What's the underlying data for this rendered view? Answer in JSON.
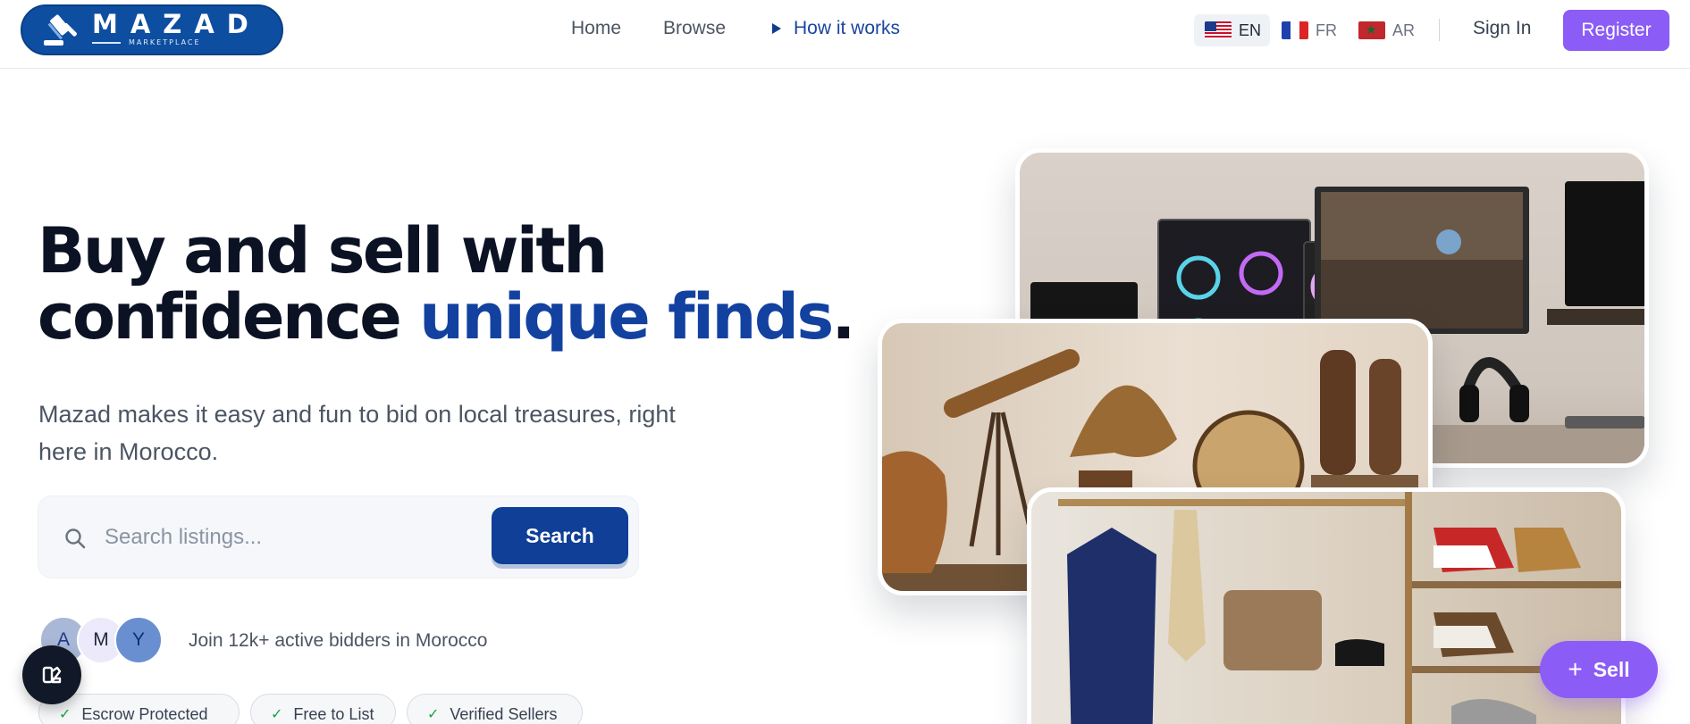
{
  "brand": {
    "name": "MAZAD",
    "tagline": "MARKETPLACE",
    "primary_color": "#0d4ea0",
    "accent_color": "#8b5cf6",
    "dark_color": "#0b1224"
  },
  "nav": {
    "home": "Home",
    "browse": "Browse",
    "how_it_works": "How it works"
  },
  "languages": [
    {
      "code": "EN",
      "flag": "us-flag-icon",
      "selected": true
    },
    {
      "code": "FR",
      "flag": "france-flag-icon",
      "selected": false
    },
    {
      "code": "AR",
      "flag": "morocco-flag-icon",
      "selected": false
    }
  ],
  "auth": {
    "sign_in": "Sign In",
    "register": "Register"
  },
  "hero": {
    "title_line1": "Buy and sell with",
    "title_line2_plain": "confidence ",
    "title_line2_accent": "unique finds",
    "title_period": ".",
    "description": "Mazad makes it easy and fun to bid on local treasures, right here in Morocco."
  },
  "search": {
    "placeholder": "Search listings...",
    "value": "",
    "button": "Search",
    "icon": "search-icon"
  },
  "social_proof": {
    "avatars": [
      "A",
      "M",
      "Y"
    ],
    "text": "Join 12k+ active bidders in Morocco"
  },
  "badges": [
    {
      "label": "Escrow Protected",
      "icon": "check-icon"
    },
    {
      "label": "Free to List",
      "icon": "check-icon"
    },
    {
      "label": "Verified Sellers",
      "icon": "check-icon"
    }
  ],
  "showcase_images": [
    {
      "subject": "electronics-photo"
    },
    {
      "subject": "antiques-photo"
    },
    {
      "subject": "fashion-photo"
    }
  ],
  "fab": {
    "sell": "Sell",
    "plus_icon": "plus-icon",
    "theme_icon": "palette-icon"
  }
}
